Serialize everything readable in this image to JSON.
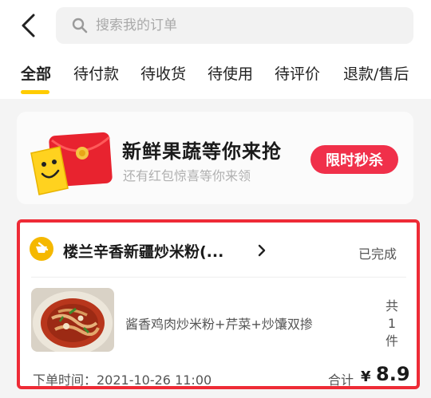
{
  "search": {
    "placeholder": "搜索我的订单"
  },
  "tabs": [
    {
      "label": "全部",
      "active": true
    },
    {
      "label": "待付款",
      "active": false
    },
    {
      "label": "待收货",
      "active": false
    },
    {
      "label": "待使用",
      "active": false
    },
    {
      "label": "待评价",
      "active": false
    },
    {
      "label": "退款/售后",
      "active": false
    }
  ],
  "promo": {
    "title": "新鲜果蔬等你来抢",
    "subtitle": "还有红包惊喜等你来领",
    "button_label": "限时秒杀"
  },
  "order": {
    "store_name": "楼兰辛香新疆炒米粉(...",
    "status": "已完成",
    "item_description": "酱香鸡肉炒米粉+芹菜+炒馕双掺",
    "item_count_prefix": "共",
    "item_count": "1",
    "item_count_suffix": "件",
    "order_time": "下单时间：2021-10-26 11:00",
    "total_label": "合计",
    "currency": "¥",
    "total_amount": "8.9"
  },
  "colors": {
    "accent_yellow": "#ffcc00",
    "promo_red": "#f0304a",
    "highlight_border": "#ee2b36"
  },
  "icons": {
    "back": "back-chevron-icon",
    "search": "search-icon",
    "store": "store-badge-icon",
    "chevron": "chevron-right-icon"
  }
}
